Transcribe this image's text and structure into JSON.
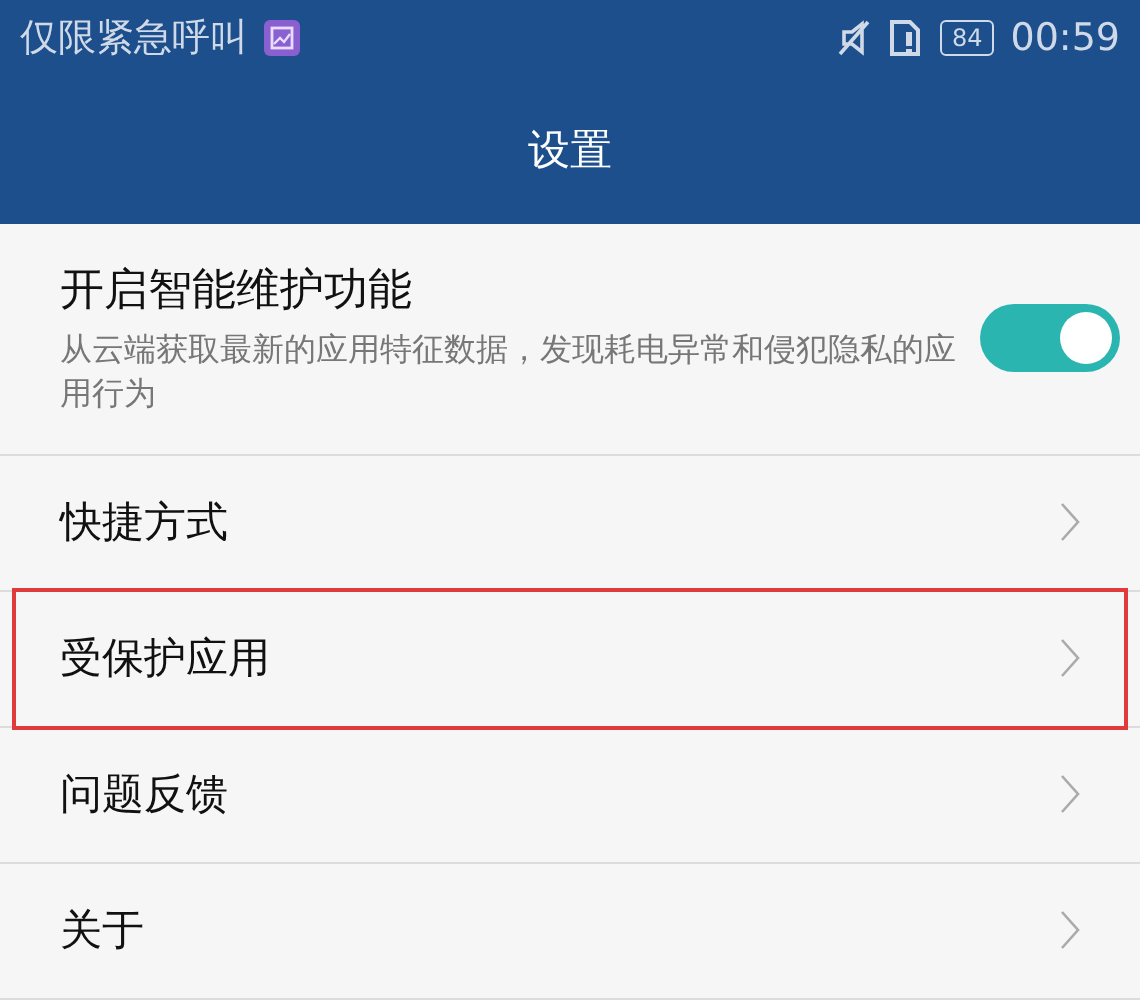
{
  "status_bar": {
    "carrier": "仅限紧急呼叫",
    "battery": "84",
    "time": "00:59"
  },
  "header": {
    "title": "设置"
  },
  "toggle": {
    "title": "开启智能维护功能",
    "description": "从云端获取最新的应用特征数据，发现耗电异常和侵犯隐私的应用行为",
    "on": true
  },
  "items": [
    {
      "label": "快捷方式",
      "highlighted": false
    },
    {
      "label": "受保护应用",
      "highlighted": true
    },
    {
      "label": "问题反馈",
      "highlighted": false
    },
    {
      "label": "关于",
      "highlighted": false
    }
  ]
}
